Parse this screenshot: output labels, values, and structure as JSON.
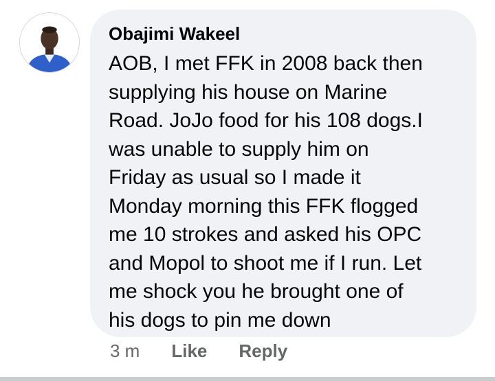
{
  "comment": {
    "author": "Obajimi Wakeel",
    "avatar_icon": "profile-photo",
    "text_lines": [
      "AOB, I met FFK in 2008 back then",
      "supplying his house on Marine",
      "Road. JoJo food for his 108 dogs.I",
      "was unable to supply him on",
      "Friday as usual so I made it",
      "Monday morning this FFK flogged",
      "me 10 strokes and asked his OPC",
      "and Mopol to shoot me if I run. Let",
      "me shock you he brought one of",
      "his dogs to pin me down"
    ],
    "timestamp": "3 m",
    "like_label": "Like",
    "reply_label": "Reply"
  },
  "colors": {
    "bubble_background": "#f0f2f5",
    "text": "#050505",
    "secondary_text": "#65676b",
    "divider": "#c9ccd1"
  }
}
